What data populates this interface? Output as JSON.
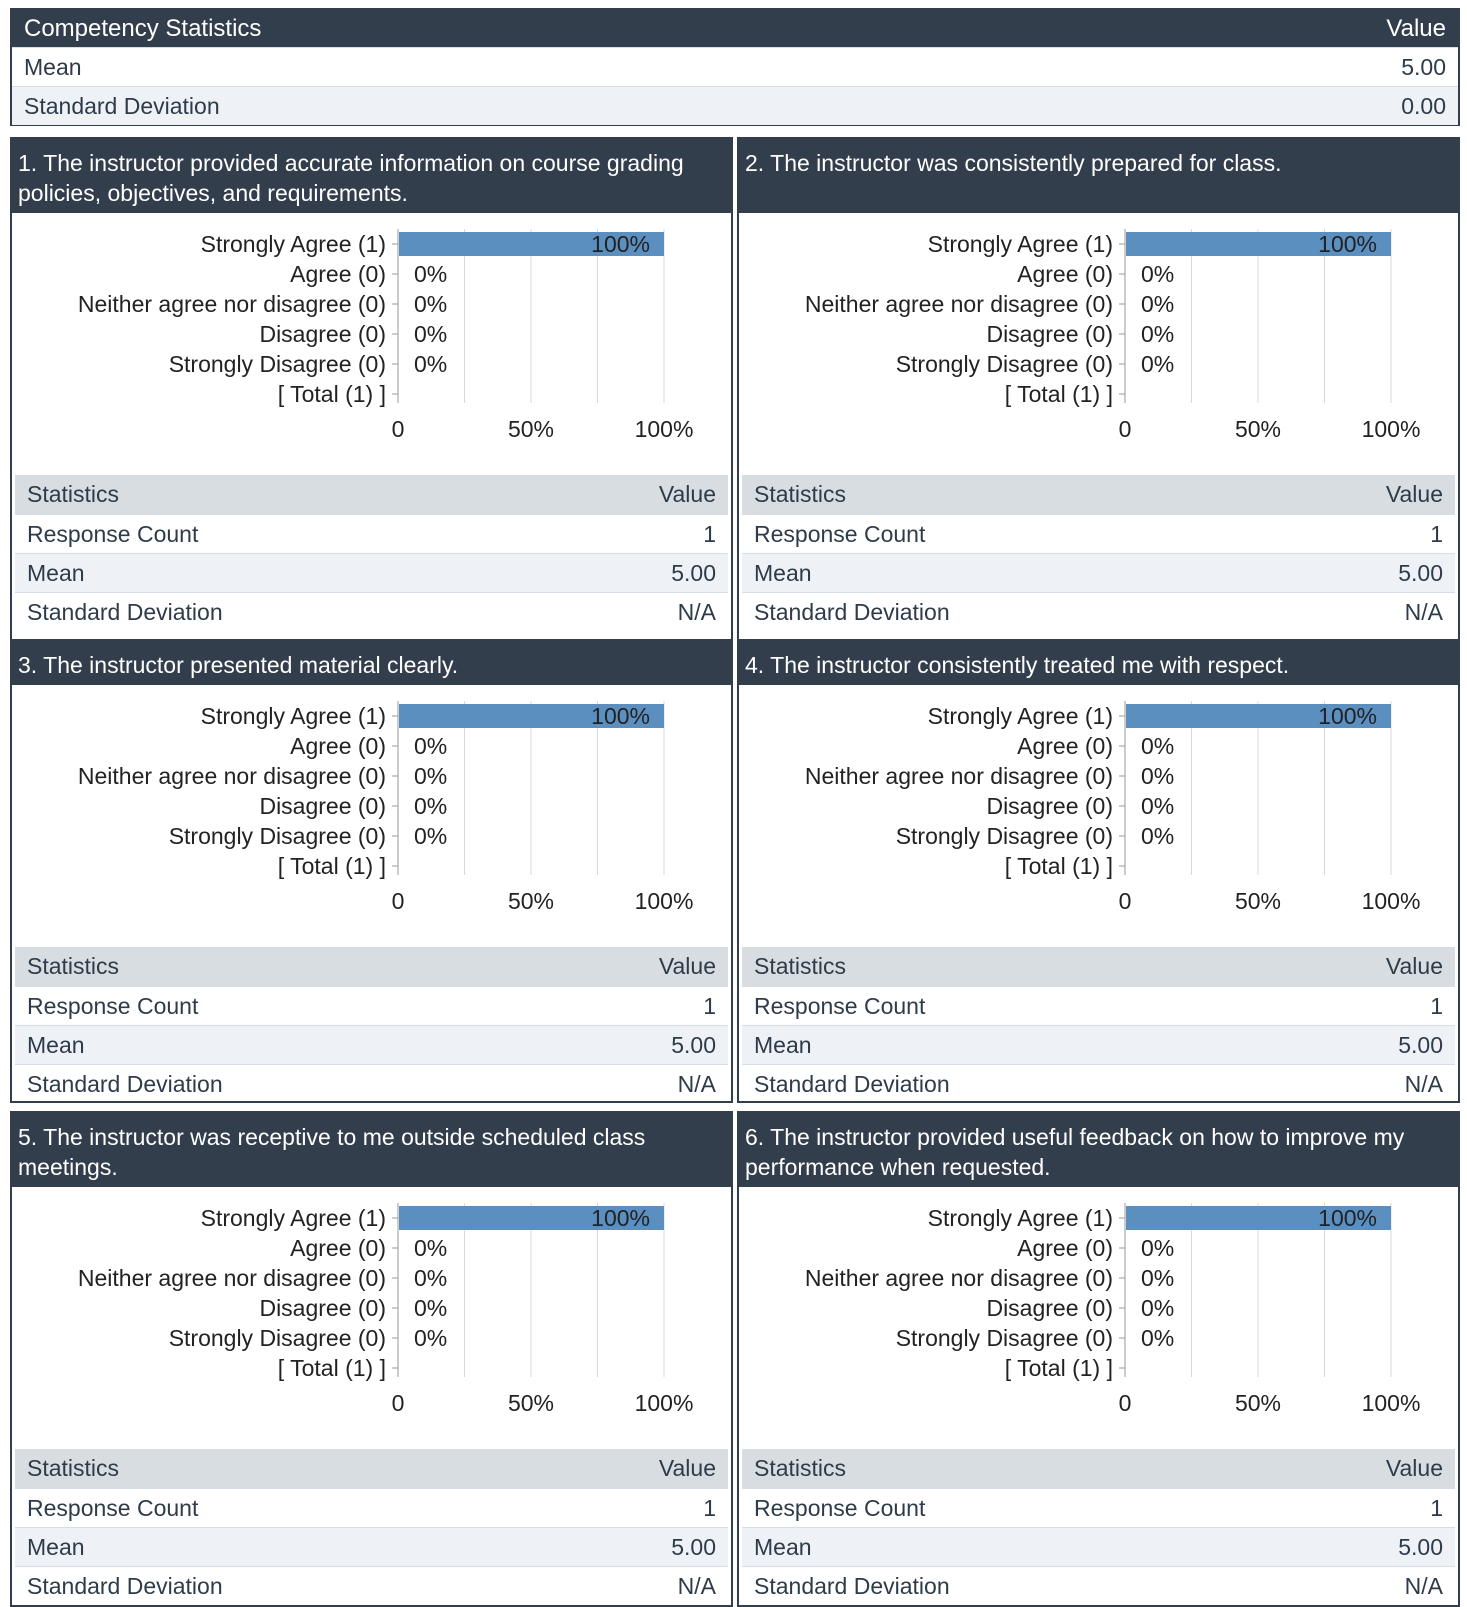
{
  "competency": {
    "header_label": "Competency Statistics",
    "header_value": "Value",
    "rows": [
      {
        "label": "Mean",
        "value": "5.00"
      },
      {
        "label": "Standard Deviation",
        "value": "0.00"
      }
    ]
  },
  "stats_header": {
    "label": "Statistics",
    "value": "Value"
  },
  "questions": [
    {
      "title": "1. The instructor provided accurate information on course grading policies, objectives, and requirements.",
      "stats": [
        {
          "label": "Response Count",
          "value": "1"
        },
        {
          "label": "Mean",
          "value": "5.00"
        },
        {
          "label": "Standard Deviation",
          "value": "N/A"
        }
      ]
    },
    {
      "title": "2. The instructor was consistently prepared for class.",
      "stats": [
        {
          "label": "Response Count",
          "value": "1"
        },
        {
          "label": "Mean",
          "value": "5.00"
        },
        {
          "label": "Standard Deviation",
          "value": "N/A"
        }
      ]
    },
    {
      "title": "3. The instructor presented material clearly.",
      "stats": [
        {
          "label": "Response Count",
          "value": "1"
        },
        {
          "label": "Mean",
          "value": "5.00"
        },
        {
          "label": "Standard Deviation",
          "value": "N/A"
        }
      ]
    },
    {
      "title": "4. The instructor consistently treated me with respect.",
      "stats": [
        {
          "label": "Response Count",
          "value": "1"
        },
        {
          "label": "Mean",
          "value": "5.00"
        },
        {
          "label": "Standard Deviation",
          "value": "N/A"
        }
      ]
    },
    {
      "title": "5. The instructor was receptive to me outside scheduled class meetings.",
      "stats": [
        {
          "label": "Response Count",
          "value": "1"
        },
        {
          "label": "Mean",
          "value": "5.00"
        },
        {
          "label": "Standard Deviation",
          "value": "N/A"
        }
      ]
    },
    {
      "title": "6. The instructor provided useful feedback on how to improve my performance when requested.",
      "stats": [
        {
          "label": "Response Count",
          "value": "1"
        },
        {
          "label": "Mean",
          "value": "5.00"
        },
        {
          "label": "Standard Deviation",
          "value": "N/A"
        }
      ]
    }
  ],
  "chart_data": [
    {
      "type": "bar",
      "orientation": "horizontal",
      "categories": [
        "Strongly Agree (1)",
        "Agree (0)",
        "Neither agree nor disagree (0)",
        "Disagree (0)",
        "Strongly Disagree (0)",
        "[ Total (1) ]"
      ],
      "values": [
        100,
        0,
        0,
        0,
        0,
        null
      ],
      "value_labels": [
        "100%",
        "0%",
        "0%",
        "0%",
        "0%",
        ""
      ],
      "xticks": [
        "0",
        "50%",
        "100%"
      ],
      "xlim": [
        0,
        100
      ],
      "bar_color": "#5b8fbf",
      "grid": true
    },
    {
      "type": "bar",
      "orientation": "horizontal",
      "categories": [
        "Strongly Agree (1)",
        "Agree (0)",
        "Neither agree nor disagree (0)",
        "Disagree (0)",
        "Strongly Disagree (0)",
        "[ Total (1) ]"
      ],
      "values": [
        100,
        0,
        0,
        0,
        0,
        null
      ],
      "value_labels": [
        "100%",
        "0%",
        "0%",
        "0%",
        "0%",
        ""
      ],
      "xticks": [
        "0",
        "50%",
        "100%"
      ],
      "xlim": [
        0,
        100
      ],
      "bar_color": "#5b8fbf",
      "grid": true
    },
    {
      "type": "bar",
      "orientation": "horizontal",
      "categories": [
        "Strongly Agree (1)",
        "Agree (0)",
        "Neither agree nor disagree (0)",
        "Disagree (0)",
        "Strongly Disagree (0)",
        "[ Total (1) ]"
      ],
      "values": [
        100,
        0,
        0,
        0,
        0,
        null
      ],
      "value_labels": [
        "100%",
        "0%",
        "0%",
        "0%",
        "0%",
        ""
      ],
      "xticks": [
        "0",
        "50%",
        "100%"
      ],
      "xlim": [
        0,
        100
      ],
      "bar_color": "#5b8fbf",
      "grid": true
    },
    {
      "type": "bar",
      "orientation": "horizontal",
      "categories": [
        "Strongly Agree (1)",
        "Agree (0)",
        "Neither agree nor disagree (0)",
        "Disagree (0)",
        "Strongly Disagree (0)",
        "[ Total (1) ]"
      ],
      "values": [
        100,
        0,
        0,
        0,
        0,
        null
      ],
      "value_labels": [
        "100%",
        "0%",
        "0%",
        "0%",
        "0%",
        ""
      ],
      "xticks": [
        "0",
        "50%",
        "100%"
      ],
      "xlim": [
        0,
        100
      ],
      "bar_color": "#5b8fbf",
      "grid": true
    },
    {
      "type": "bar",
      "orientation": "horizontal",
      "categories": [
        "Strongly Agree (1)",
        "Agree (0)",
        "Neither agree nor disagree (0)",
        "Disagree (0)",
        "Strongly Disagree (0)",
        "[ Total (1) ]"
      ],
      "values": [
        100,
        0,
        0,
        0,
        0,
        null
      ],
      "value_labels": [
        "100%",
        "0%",
        "0%",
        "0%",
        "0%",
        ""
      ],
      "xticks": [
        "0",
        "50%",
        "100%"
      ],
      "xlim": [
        0,
        100
      ],
      "bar_color": "#5b8fbf",
      "grid": true
    },
    {
      "type": "bar",
      "orientation": "horizontal",
      "categories": [
        "Strongly Agree (1)",
        "Agree (0)",
        "Neither agree nor disagree (0)",
        "Disagree (0)",
        "Strongly Disagree (0)",
        "[ Total (1) ]"
      ],
      "values": [
        100,
        0,
        0,
        0,
        0,
        null
      ],
      "value_labels": [
        "100%",
        "0%",
        "0%",
        "0%",
        "0%",
        ""
      ],
      "xticks": [
        "0",
        "50%",
        "100%"
      ],
      "xlim": [
        0,
        100
      ],
      "bar_color": "#5b8fbf",
      "grid": true
    }
  ]
}
